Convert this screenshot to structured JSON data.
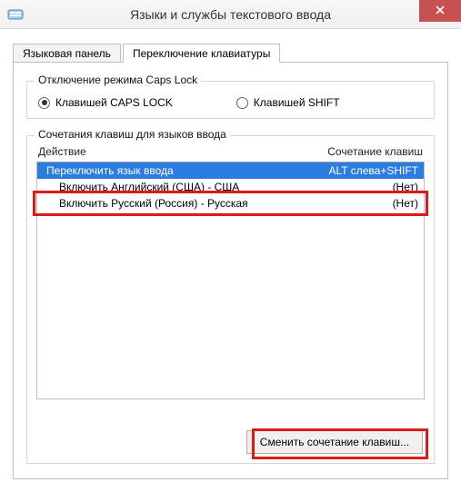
{
  "window": {
    "title": "Языки и службы текстового ввода"
  },
  "tabs": {
    "0": {
      "label": "Языковая панель"
    },
    "1": {
      "label": "Переключение клавиатуры"
    }
  },
  "capslock_group": {
    "legend": "Отключение режима Caps Lock",
    "opt_caps": "Клавишей CAPS LOCK",
    "opt_shift": "Клавишей SHIFT"
  },
  "hotkeys_group": {
    "legend": "Сочетания клавиш для языков ввода",
    "col_action": "Действие",
    "col_key": "Сочетание клавиш",
    "rows": {
      "0": {
        "action": "Переключить язык ввода",
        "key": "ALT слева+SHIFT"
      },
      "1": {
        "action": "Включить Английский (США) - США",
        "key": "(Нет)"
      },
      "2": {
        "action": "Включить Русский (Россия) - Русская",
        "key": "(Нет)"
      }
    },
    "change_button": "Сменить сочетание клавиш..."
  }
}
